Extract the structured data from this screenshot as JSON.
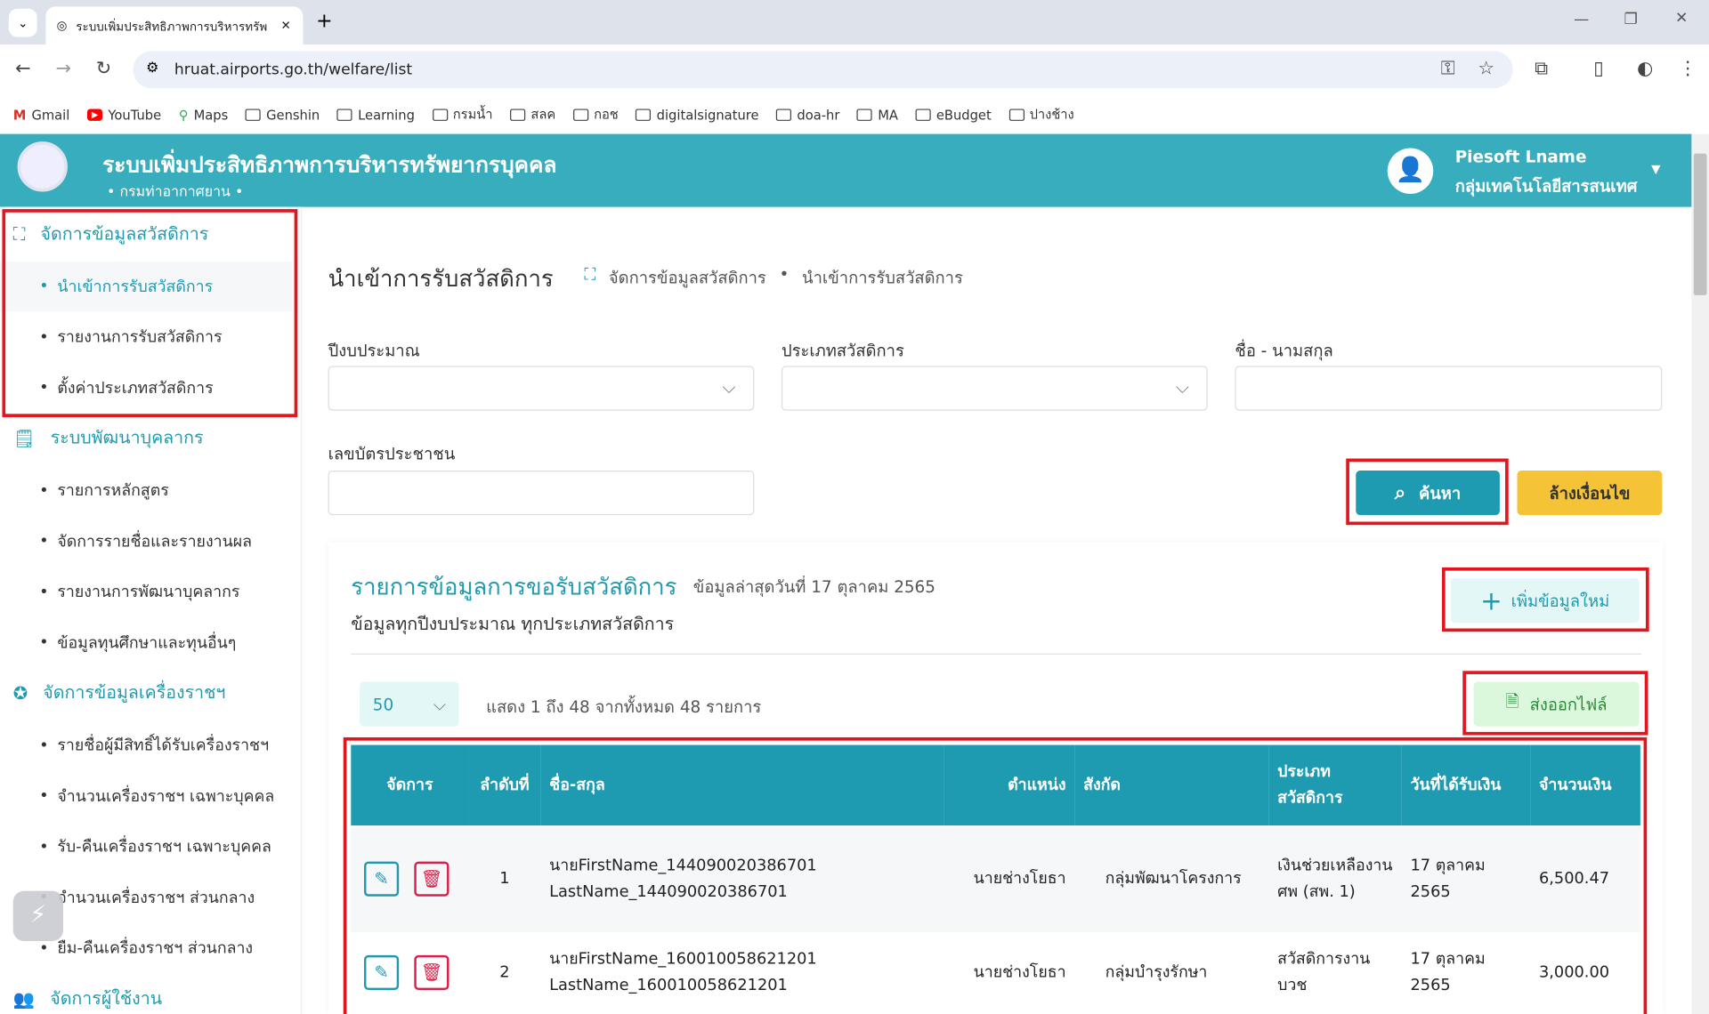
{
  "browser": {
    "tab_title": "ระบบเพิ่มประสิทธิภาพการบริหารทรัพ",
    "url": "hruat.airports.go.th/welfare/list",
    "bookmarks": [
      "Gmail",
      "YouTube",
      "Maps",
      "Genshin",
      "Learning",
      "กรมน้ำ",
      "สลค",
      "กอช",
      "digitalsignature",
      "doa-hr",
      "MA",
      "eBudget",
      "ปางช้าง"
    ]
  },
  "header": {
    "title": "ระบบเพิ่มประสิทธิภาพการบริหารทรัพยากรบุคคล",
    "subtitle": "• กรมท่าอากาศยาน •",
    "user_name": "Piesoft Lname",
    "user_dept": "กลุ่มเทคโนโลยีสารสนเทศ"
  },
  "sidebar": {
    "groups": [
      {
        "label": "จัดการข้อมูลสวัสดิการ",
        "items": [
          "นำเข้าการรับสวัสดิการ",
          "รายงานการรับสวัสดิการ",
          "ตั้งค่าประเภทสวัสดิการ"
        ]
      },
      {
        "label": "ระบบพัฒนาบุคลากร",
        "items": [
          "รายการหลักสูตร",
          "จัดการรายชื่อและรายงานผล",
          "รายงานการพัฒนาบุคลากร",
          "ข้อมูลทุนศึกษาและทุนอื่นๆ"
        ]
      },
      {
        "label": "จัดการข้อมูลเครื่องราชฯ",
        "items": [
          "รายชื่อผู้มีสิทธิ์ได้รับเครื่องราชฯ",
          "จำนวนเครื่องราชฯ เฉพาะบุคคล",
          "รับ-คืนเครื่องราชฯ เฉพาะบุคคล",
          "จำนวนเครื่องราชฯ ส่วนกลาง",
          "ยืม-คืนเครื่องราชฯ ส่วนกลาง"
        ]
      },
      {
        "label": "จัดการผู้ใช้งาน",
        "items": []
      }
    ]
  },
  "page": {
    "title": "นำเข้าการรับสวัสดิการ",
    "breadcrumb": [
      "จัดการข้อมูลสวัสดิการ",
      "นำเข้าการรับสวัสดิการ"
    ]
  },
  "filters": {
    "budget_year_label": "ปีงบประมาณ",
    "budget_year_value": "",
    "welfare_type_label": "ประเภทสวัสดิการ",
    "welfare_type_value": "",
    "name_label": "ชื่อ - นามสกุล",
    "name_value": "",
    "id_label": "เลขบัตรประชาชน",
    "id_value": "",
    "search_button": "ค้นหา",
    "clear_button": "ล้างเงื่อนไข"
  },
  "list": {
    "title": "รายการข้อมูลการขอรับสวัสดิการ",
    "updated": "ข้อมูลล่าสุดวันที่ 17 ตุลาคม 2565",
    "subtitle": "ข้อมูลทุกปีงบประมาณ ทุกประเภทสวัสดิการ",
    "add_button": "เพิ่มข้อมูลใหม่",
    "export_button": "ส่งออกไฟล์",
    "page_size": "50",
    "summary": "แสดง 1 ถึง 48 จากทั้งหมด 48 รายการ",
    "columns": [
      "จัดการ",
      "ลำดับที่",
      "ชื่อ-สกุล",
      "ตำแหน่ง",
      "สังกัด",
      "ประเภทสวัสดิการ",
      "วันที่ได้รับเงิน",
      "จำนวนเงิน"
    ],
    "rows": [
      {
        "no": "1",
        "name1": "นายFirstName_144090020386701",
        "name2": "LastName_144090020386701",
        "position": "นายช่างโยธา",
        "unit": "กลุ่มพัฒนาโครงการ",
        "type": "เงินช่วยเหลืองานศพ (สพ. 1)",
        "date": "17 ตุลาคม 2565",
        "amount": "6,500.47"
      },
      {
        "no": "2",
        "name1": "นายFirstName_160010058621201",
        "name2": "LastName_160010058621201",
        "position": "นายช่างโยธา",
        "unit": "กลุ่มบำรุงรักษา",
        "type": "สวัสดิการงานบวช",
        "date": "17 ตุลาคม 2565",
        "amount": "3,000.00"
      }
    ]
  },
  "colors": {
    "header": "#37adbd",
    "table_header": "#1e9bb0",
    "accent": "#1f9aaf",
    "search": "#1e9bb0",
    "clear": "#f5c436",
    "highlight": "#e3161f"
  }
}
